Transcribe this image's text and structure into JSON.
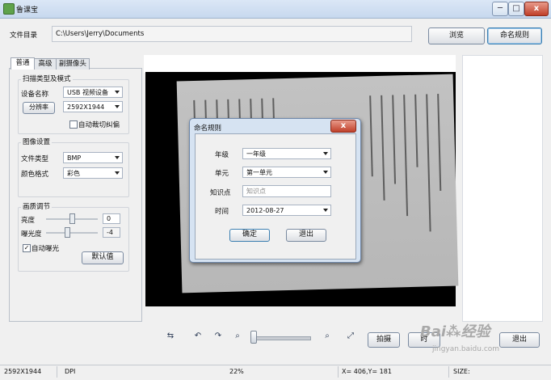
{
  "window": {
    "title": "鲁课宝",
    "minimize": "─",
    "maximize": "□",
    "close": "x"
  },
  "file_dir": {
    "label": "文件目录",
    "value": "C:\\Users\\Jerry\\Documents",
    "browse": "浏览",
    "naming_rules": "命名规则"
  },
  "tabs": [
    "普通",
    "高级",
    "副摄像头"
  ],
  "scan": {
    "group_title": "扫描类型及模式",
    "device_label": "设备名称",
    "device_value": "USB 视频设备",
    "resolution_button": "分辨率",
    "resolution_value": "2592X1944",
    "auto_crop_label": "自动裁切纠偏",
    "auto_crop_checked": false
  },
  "image": {
    "group_title": "图像设置",
    "file_type_label": "文件类型",
    "file_type_value": "BMP",
    "color_label": "颜色格式",
    "color_value": "彩色"
  },
  "quality": {
    "group_title": "画质调节",
    "brightness_label": "亮度",
    "brightness_value": "0",
    "exposure_label": "曝光度",
    "exposure_value": "-4",
    "auto_exposure_label": "自动曝光",
    "auto_exposure_checked": true,
    "default_button": "默认值"
  },
  "dialog": {
    "title": "命名规则",
    "close": "x",
    "grade_label": "年级",
    "grade_value": "一年级",
    "unit_label": "单元",
    "unit_value": "第一单元",
    "knowledge_label": "知识点",
    "knowledge_placeholder": "知识点",
    "time_label": "时间",
    "time_value": "2012-08-27",
    "ok_button": "确定",
    "exit_button": "退出"
  },
  "toolbar": {
    "capture_button": "拍摄",
    "second_button": "时",
    "exit_button": "退出",
    "icons": [
      "rotate-icon",
      "rotate-left-icon",
      "rotate-right-icon",
      "zoom-out-icon",
      "zoom-in-icon",
      "fit-screen-icon"
    ]
  },
  "status": {
    "resolution": "2592X1944",
    "dpi": "DPI",
    "zoom": "22%",
    "coords": "X= 406,Y= 181",
    "size": "SIZE:"
  },
  "watermark": {
    "site": "jingyan.baidu.com",
    "brand_left": "Bai",
    "brand_right": "经验"
  },
  "colors": {
    "accent_border": "#3c7fb1",
    "dialog_bg": "#d6e3f2",
    "close_red": "#c0402a"
  }
}
